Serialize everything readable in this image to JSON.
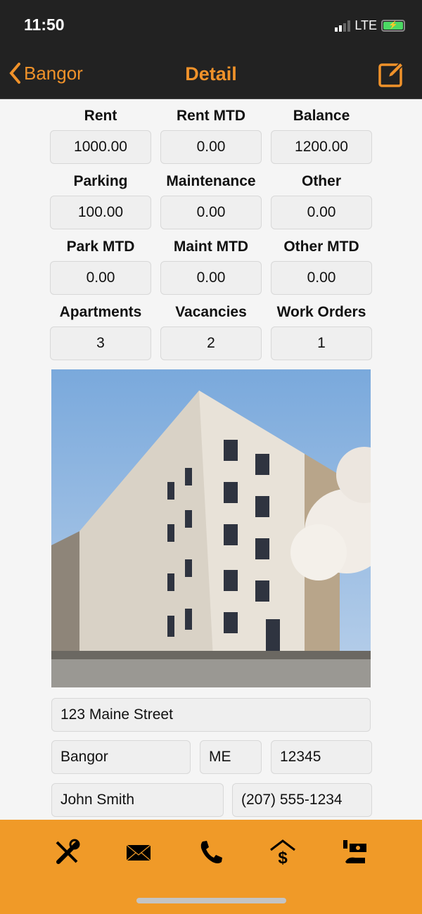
{
  "status": {
    "time": "11:50",
    "network": "LTE"
  },
  "nav": {
    "back_label": "Bangor",
    "title": "Detail",
    "accent": "#f0922a"
  },
  "stats": [
    {
      "label": "Rent",
      "value": "1000.00"
    },
    {
      "label": "Rent MTD",
      "value": "0.00"
    },
    {
      "label": "Balance",
      "value": "1200.00"
    },
    {
      "label": "Parking",
      "value": "100.00"
    },
    {
      "label": "Maintenance",
      "value": "0.00"
    },
    {
      "label": "Other",
      "value": "0.00"
    },
    {
      "label": "Park MTD",
      "value": "0.00"
    },
    {
      "label": "Maint MTD",
      "value": "0.00"
    },
    {
      "label": "Other MTD",
      "value": "0.00"
    },
    {
      "label": "Apartments",
      "value": "3"
    },
    {
      "label": "Vacancies",
      "value": "2"
    },
    {
      "label": "Work Orders",
      "value": "1"
    }
  ],
  "address": {
    "street": "123 Maine Street",
    "city": "Bangor",
    "state": "ME",
    "zip": "12345",
    "contact": "John Smith",
    "phone": "(207) 555-1234"
  },
  "toolbar": {
    "color": "#f09a28",
    "icons": [
      "tools-icon",
      "mail-icon",
      "phone-icon",
      "house-dollar-icon",
      "hand-money-icon"
    ]
  }
}
